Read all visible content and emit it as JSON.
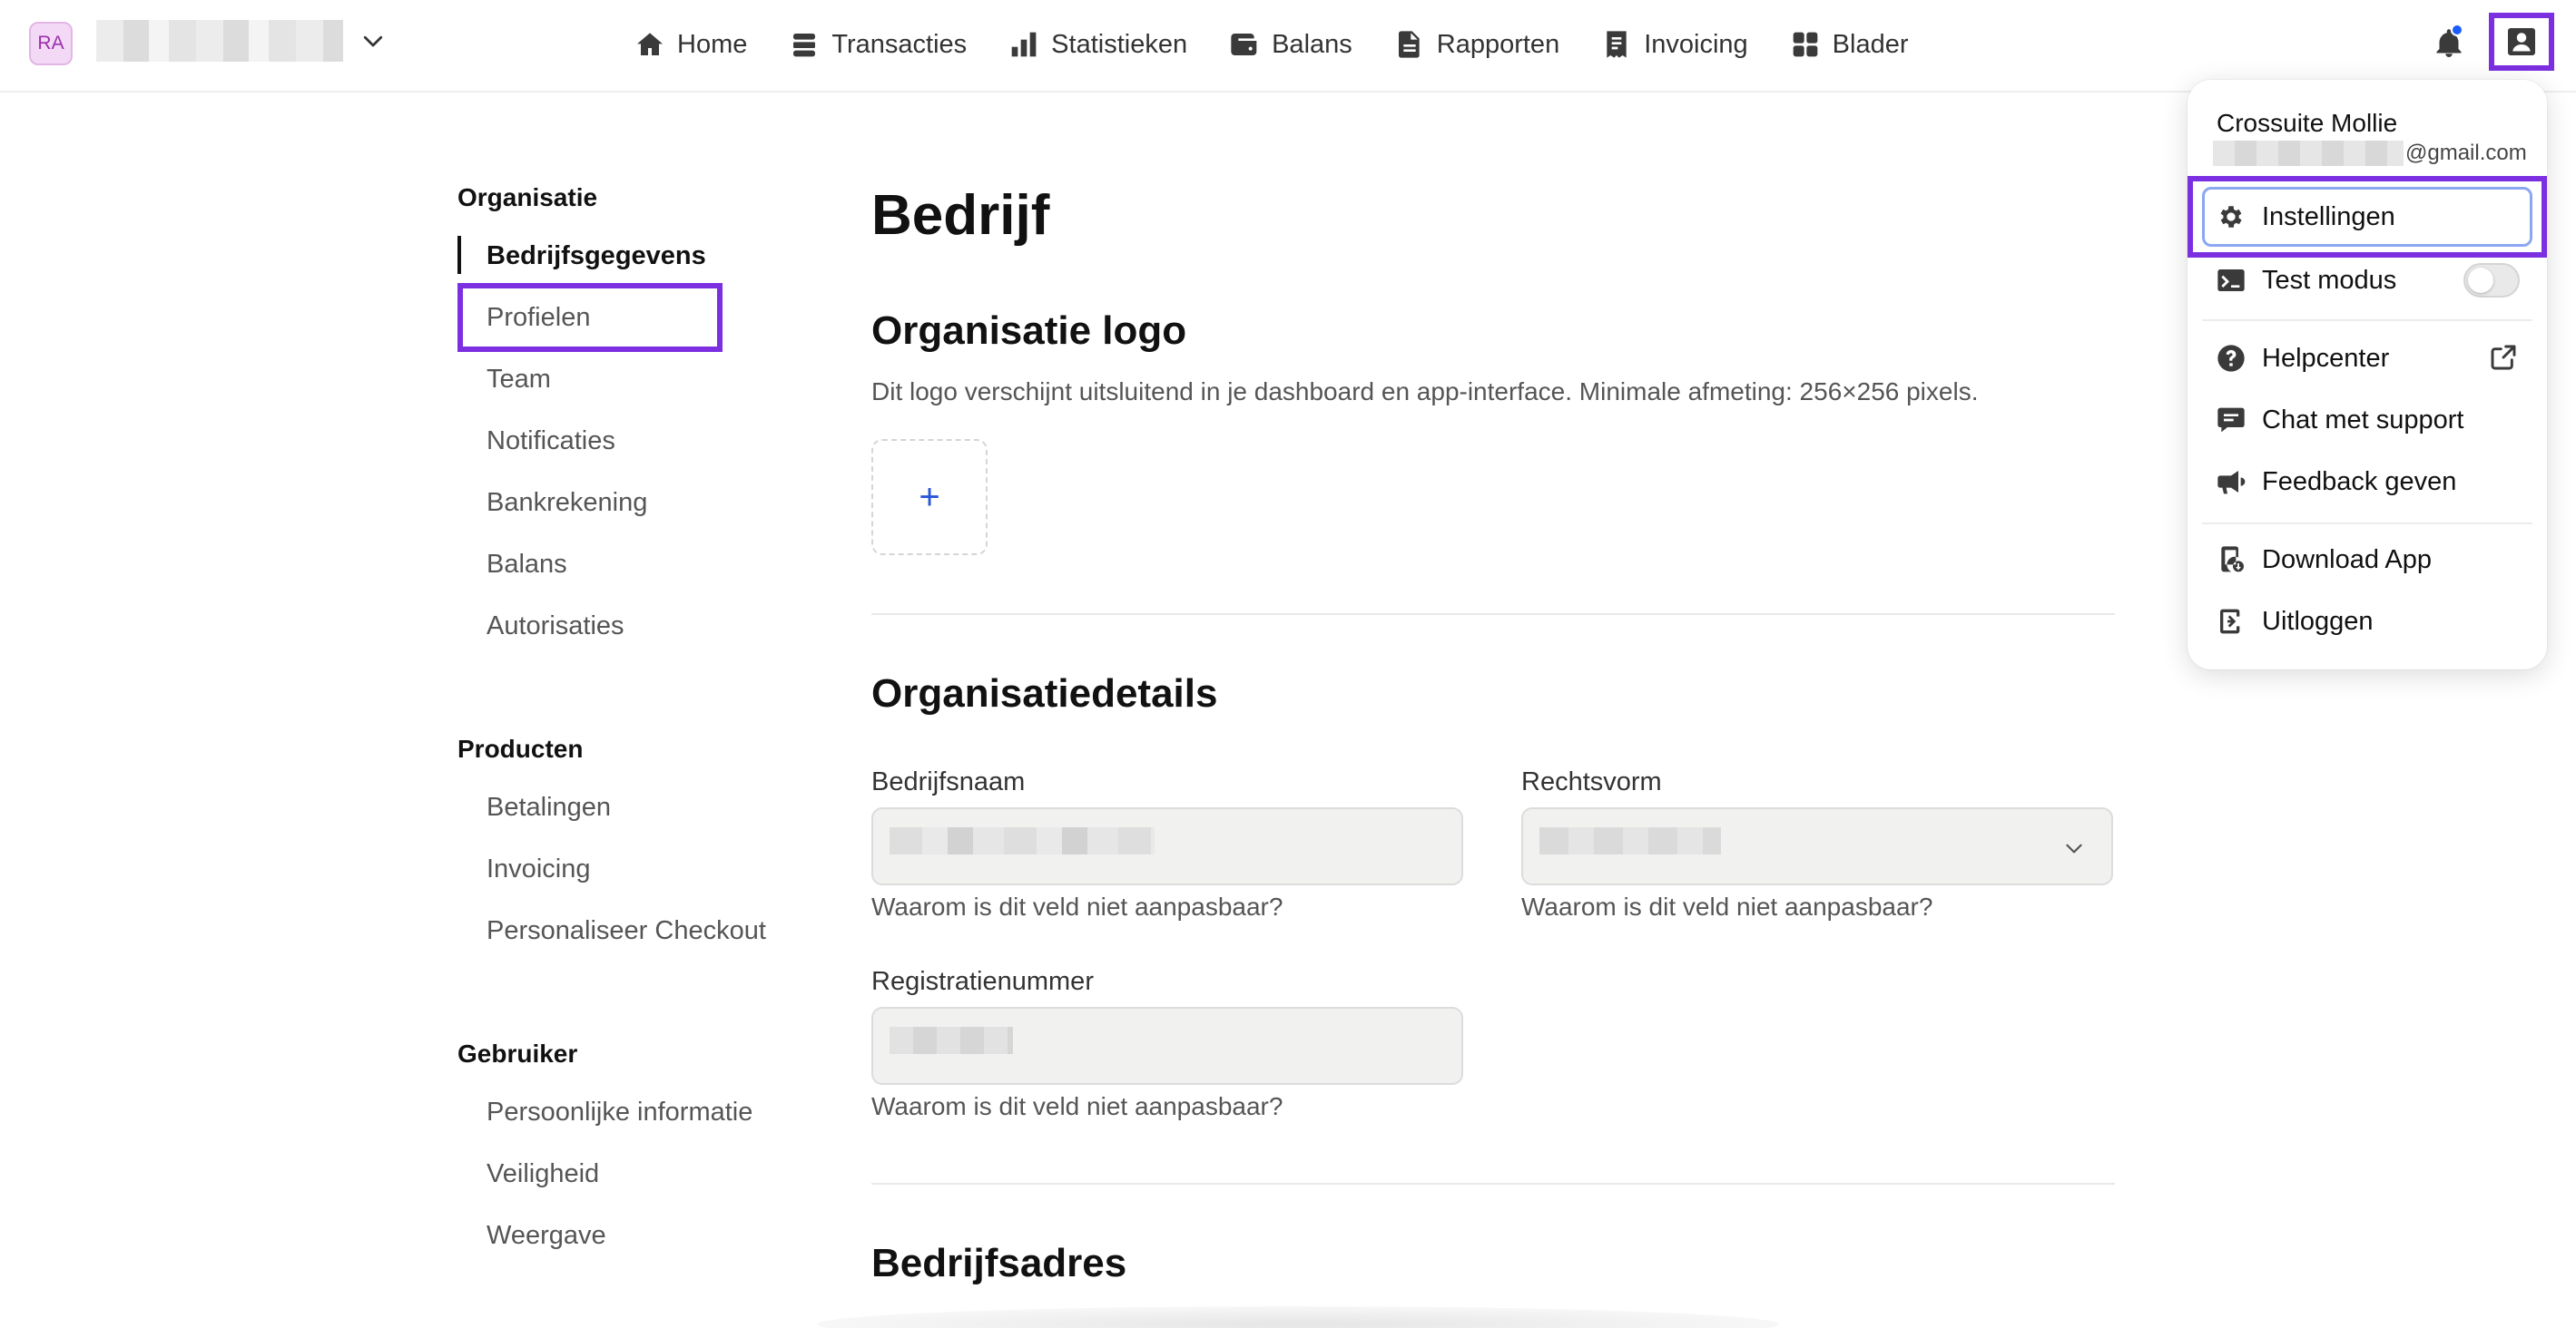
{
  "topbar": {
    "org_initials": "RA",
    "nav": [
      {
        "label": "Home",
        "icon": "home-icon"
      },
      {
        "label": "Transacties",
        "icon": "transactions-icon"
      },
      {
        "label": "Statistieken",
        "icon": "bar-chart-icon"
      },
      {
        "label": "Balans",
        "icon": "wallet-icon"
      },
      {
        "label": "Rapporten",
        "icon": "document-icon"
      },
      {
        "label": "Invoicing",
        "icon": "invoice-icon"
      },
      {
        "label": "Blader",
        "icon": "grid-icon"
      }
    ]
  },
  "sidebar": {
    "groups": [
      {
        "title": "Organisatie",
        "items": [
          "Bedrijfsgegevens",
          "Profielen",
          "Team",
          "Notificaties",
          "Bankrekening",
          "Balans",
          "Autorisaties"
        ]
      },
      {
        "title": "Producten",
        "items": [
          "Betalingen",
          "Invoicing",
          "Personaliseer Checkout"
        ]
      },
      {
        "title": "Gebruiker",
        "items": [
          "Persoonlijke informatie",
          "Veiligheid",
          "Weergave"
        ]
      }
    ],
    "active_item": "Bedrijfsgegevens"
  },
  "main": {
    "title": "Bedrijf",
    "logo_section": {
      "heading": "Organisatie logo",
      "description": "Dit logo verschijnt uitsluitend in je dashboard en app-interface. Minimale afmeting: 256×256 pixels.",
      "add_symbol": "+"
    },
    "details_section": {
      "heading": "Organisatiedetails",
      "fields": [
        {
          "label": "Bedrijfsnaam",
          "help": "Waarom is dit veld niet aanpasbaar?"
        },
        {
          "label": "Rechtsvorm",
          "help": "Waarom is dit veld niet aanpasbaar?"
        },
        {
          "label": "Registratienummer",
          "help": "Waarom is dit veld niet aanpasbaar?"
        }
      ]
    },
    "address_section": {
      "heading": "Bedrijfsadres"
    }
  },
  "user_menu": {
    "name": "Crossuite Mollie",
    "email_suffix": "@gmail.com",
    "items": [
      {
        "label": "Instellingen",
        "icon": "gear-icon"
      },
      {
        "label": "Test modus",
        "icon": "terminal-icon",
        "toggle": false
      },
      {
        "label": "Helpcenter",
        "icon": "help-icon"
      },
      {
        "label": "Chat met support",
        "icon": "chat-icon"
      },
      {
        "label": "Feedback geven",
        "icon": "megaphone-icon"
      },
      {
        "label": "Download App",
        "icon": "phone-download-icon"
      },
      {
        "label": "Uitloggen",
        "icon": "logout-icon"
      }
    ]
  },
  "colors": {
    "highlight": "#7b2fe0",
    "notification_dot": "#1a5cff",
    "plus_accent": "#2a56d8"
  }
}
